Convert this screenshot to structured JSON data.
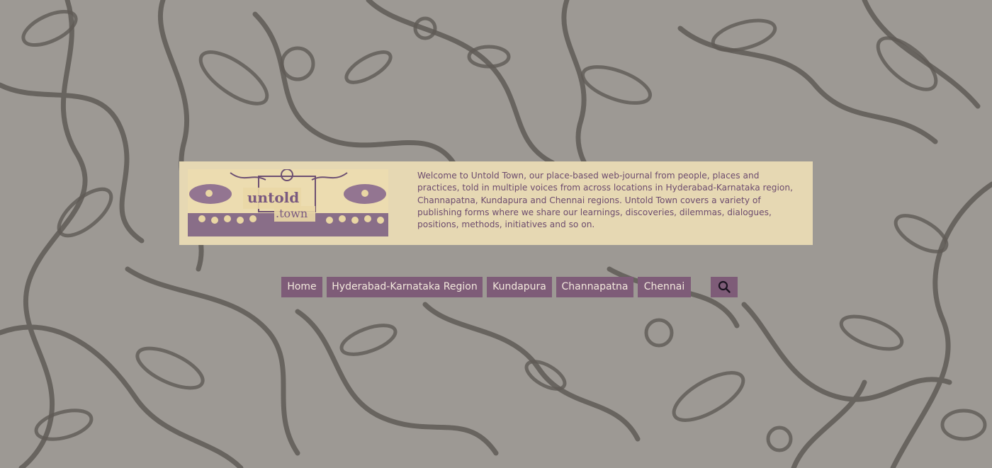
{
  "site": {
    "logo_text_top": "untold",
    "logo_text_bottom": ".town",
    "intro": "Welcome to Untold Town, our place-based web-journal from people, places and practices, told in multiple voices from across locations in Hyderabad-Karnataka region, Channapatna, Kundapura and Chennai regions. Untold Town covers a variety of publishing forms where we share our learnings, discoveries, dilemmas, dialogues, positions, methods, initiatives and so on."
  },
  "nav": {
    "items": [
      {
        "label": "Home"
      },
      {
        "label": "Hyderabad-Karnataka Region"
      },
      {
        "label": "Kundapura"
      },
      {
        "label": "Channapatna"
      },
      {
        "label": "Chennai"
      }
    ],
    "search_icon": "search-icon"
  },
  "colors": {
    "background": "#9b9792",
    "pattern_stroke": "#5e5a55",
    "card_bg": "#e6d8b3",
    "intro_text": "#6d4c6e",
    "nav_bg": "#7e5c78",
    "nav_text": "#f3e9dd"
  }
}
